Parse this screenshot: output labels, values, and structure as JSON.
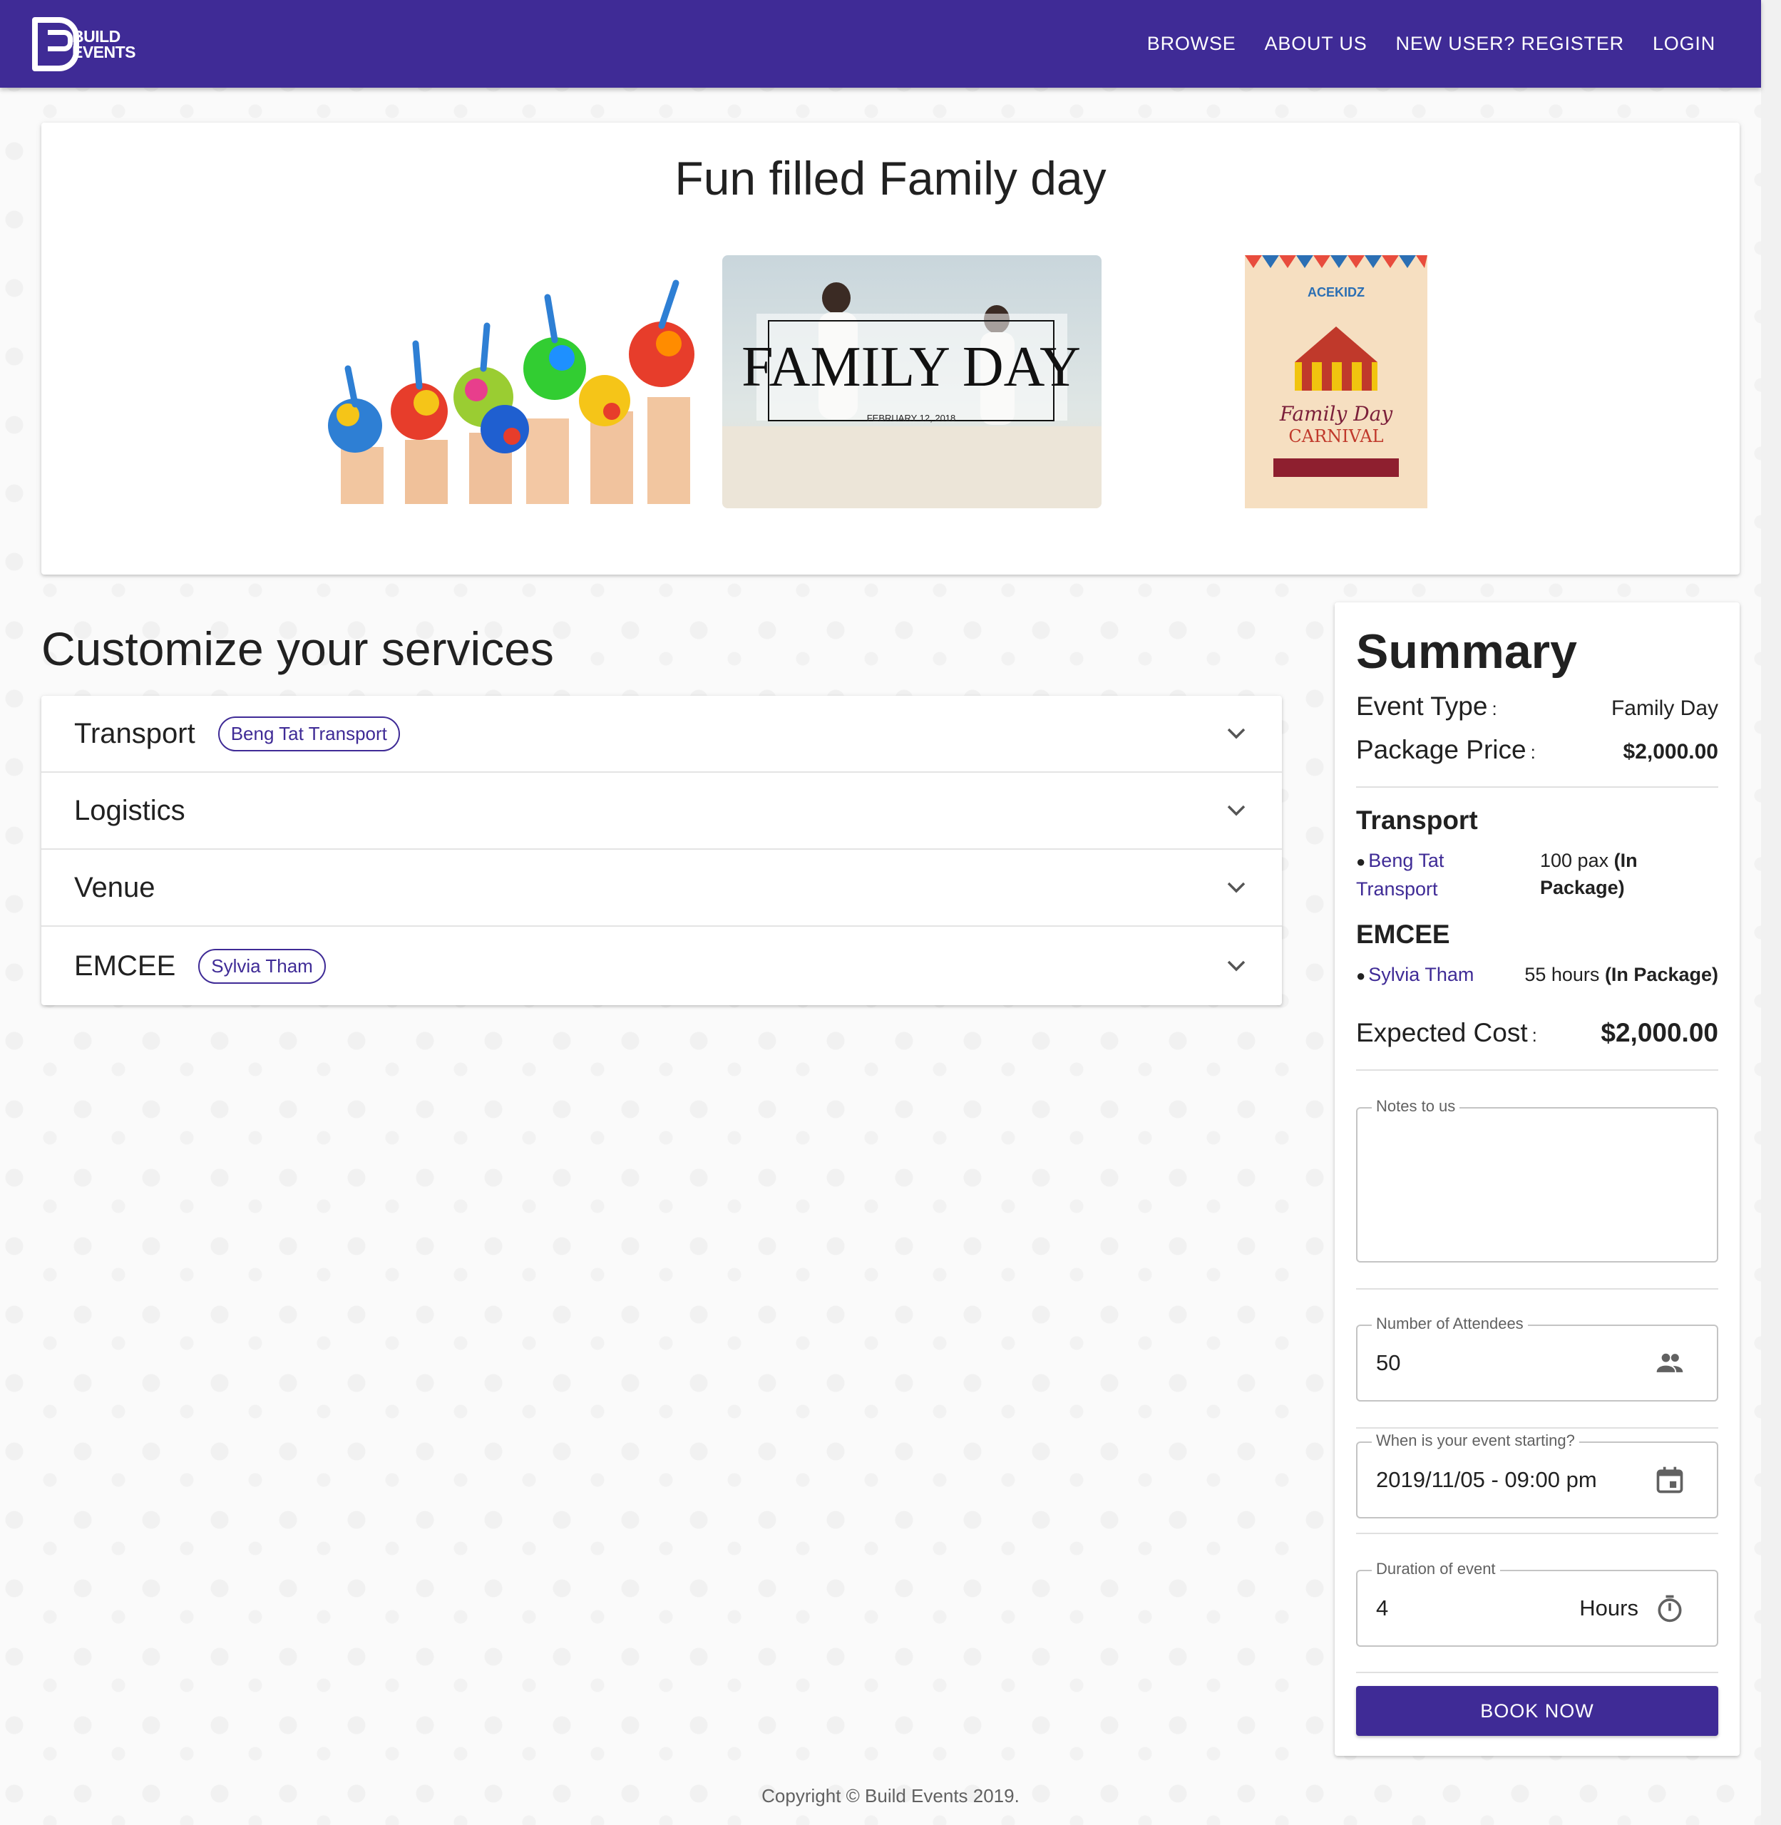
{
  "brand": {
    "logo_top": "BUILD",
    "logo_bottom": "EVENTS",
    "accent": "#3f2b96"
  },
  "nav": {
    "items": [
      "BROWSE",
      "ABOUT US",
      "NEW USER? REGISTER",
      "LOGIN"
    ]
  },
  "hero": {
    "title": "Fun filled Family day"
  },
  "images": {
    "family_banner_title": "FAMILY DAY",
    "family_banner_date": "FEBRUARY 12, 2018",
    "poster_line1": "Family Day",
    "poster_line2": "CARNIVAL",
    "poster_brand": "ACEKIDZ"
  },
  "customize": {
    "title": "Customize your services",
    "services": [
      {
        "label": "Transport",
        "chip": "Beng Tat Transport"
      },
      {
        "label": "Logistics",
        "chip": ""
      },
      {
        "label": "Venue",
        "chip": ""
      },
      {
        "label": "EMCEE",
        "chip": "Sylvia Tham"
      }
    ]
  },
  "summary": {
    "title": "Summary",
    "event_type_label": "Event Type",
    "event_type_value": "Family Day",
    "package_price_label": "Package Price",
    "package_price_value": "$2,000.00",
    "transport_heading": "Transport",
    "transport_vendor_line1": "Beng Tat",
    "transport_vendor_line2": "Transport",
    "transport_qty": "100 pax",
    "transport_note_a": "(In",
    "transport_note_b": "Package)",
    "emcee_heading": "EMCEE",
    "emcee_vendor": "Sylvia Tham",
    "emcee_qty": "55 hours",
    "emcee_note": "(In Package)",
    "expected_cost_label": "Expected Cost",
    "expected_cost_value": "$2,000.00",
    "colon": ":"
  },
  "form": {
    "notes_label": "Notes to us",
    "notes_value": "",
    "attendees_label": "Number of Attendees",
    "attendees_value": "50",
    "start_label": "When is your event starting?",
    "start_value": "2019/11/05 - 09:00 pm",
    "duration_label": "Duration of event",
    "duration_value": "4",
    "duration_unit": "Hours",
    "book_label": "BOOK NOW"
  },
  "footer": {
    "copyright": "Copyright © Build Events 2019."
  }
}
